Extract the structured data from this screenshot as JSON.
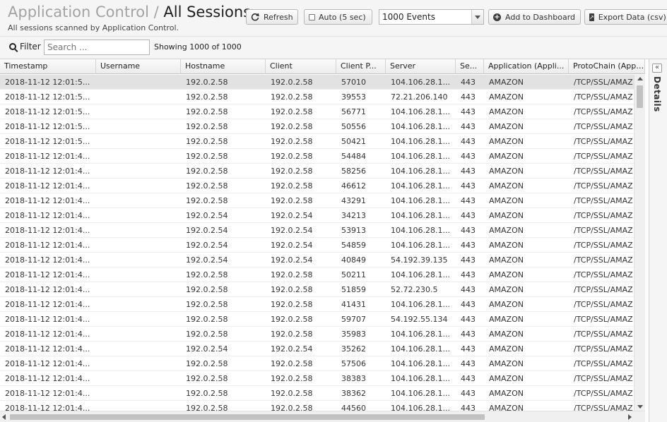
{
  "header": {
    "app_name": "Application Control",
    "separator": "/",
    "page_title": "All Sessions",
    "subtitle": "All sessions scanned by Application Control.",
    "refresh_label": "Refresh",
    "auto_label": "Auto (5 sec)",
    "events_select": "1000 Events",
    "add_dashboard_label": "Add to Dashboard",
    "export_label": "Export Data (csv)"
  },
  "filter": {
    "label": "Filter",
    "placeholder": "Search ...",
    "showing": "Showing 1000 of 1000"
  },
  "details": {
    "label": "Details",
    "collapse_icon": "«"
  },
  "grid": {
    "columns": [
      "Timestamp",
      "Username",
      "Hostname",
      "Client",
      "Client P...",
      "Server",
      "Se...",
      "Application (Appli...",
      "ProtoChain (Appl..."
    ],
    "rows": [
      [
        "2018-11-12 12:01:5...",
        "",
        "192.0.2.58",
        "192.0.2.58",
        "57010",
        "104.106.28.1...",
        "443",
        "AMAZON",
        "/TCP/SSL/AMAZ"
      ],
      [
        "2018-11-12 12:01:5...",
        "",
        "192.0.2.58",
        "192.0.2.58",
        "39553",
        "72.21.206.140",
        "443",
        "AMAZON",
        "/TCP/SSL/AMAZ"
      ],
      [
        "2018-11-12 12:01:5...",
        "",
        "192.0.2.58",
        "192.0.2.58",
        "56771",
        "104.106.28.1...",
        "443",
        "AMAZON",
        "/TCP/SSL/AMAZ"
      ],
      [
        "2018-11-12 12:01:5...",
        "",
        "192.0.2.58",
        "192.0.2.58",
        "50556",
        "104.106.28.1...",
        "443",
        "AMAZON",
        "/TCP/SSL/AMAZ"
      ],
      [
        "2018-11-12 12:01:5...",
        "",
        "192.0.2.58",
        "192.0.2.58",
        "50421",
        "104.106.28.1...",
        "443",
        "AMAZON",
        "/TCP/SSL/AMAZ"
      ],
      [
        "2018-11-12 12:01:4...",
        "",
        "192.0.2.58",
        "192.0.2.58",
        "54484",
        "104.106.28.1...",
        "443",
        "AMAZON",
        "/TCP/SSL/AMAZ"
      ],
      [
        "2018-11-12 12:01:4...",
        "",
        "192.0.2.58",
        "192.0.2.58",
        "58256",
        "104.106.28.1...",
        "443",
        "AMAZON",
        "/TCP/SSL/AMAZ"
      ],
      [
        "2018-11-12 12:01:4...",
        "",
        "192.0.2.58",
        "192.0.2.58",
        "46612",
        "104.106.28.1...",
        "443",
        "AMAZON",
        "/TCP/SSL/AMAZ"
      ],
      [
        "2018-11-12 12:01:4...",
        "",
        "192.0.2.58",
        "192.0.2.58",
        "43291",
        "104.106.28.1...",
        "443",
        "AMAZON",
        "/TCP/SSL/AMAZ"
      ],
      [
        "2018-11-12 12:01:4...",
        "",
        "192.0.2.54",
        "192.0.2.54",
        "34213",
        "104.106.28.1...",
        "443",
        "AMAZON",
        "/TCP/SSL/AMAZ"
      ],
      [
        "2018-11-12 12:01:4...",
        "",
        "192.0.2.54",
        "192.0.2.54",
        "53913",
        "104.106.28.1...",
        "443",
        "AMAZON",
        "/TCP/SSL/AMAZ"
      ],
      [
        "2018-11-12 12:01:4...",
        "",
        "192.0.2.54",
        "192.0.2.54",
        "54859",
        "104.106.28.1...",
        "443",
        "AMAZON",
        "/TCP/SSL/AMAZ"
      ],
      [
        "2018-11-12 12:01:4...",
        "",
        "192.0.2.54",
        "192.0.2.54",
        "40849",
        "54.192.39.135",
        "443",
        "AMAZON",
        "/TCP/SSL/AMAZ"
      ],
      [
        "2018-11-12 12:01:4...",
        "",
        "192.0.2.58",
        "192.0.2.58",
        "50211",
        "104.106.28.1...",
        "443",
        "AMAZON",
        "/TCP/SSL/AMAZ"
      ],
      [
        "2018-11-12 12:01:4...",
        "",
        "192.0.2.58",
        "192.0.2.58",
        "51859",
        "52.72.230.5",
        "443",
        "AMAZON",
        "/TCP/SSL/AMAZ"
      ],
      [
        "2018-11-12 12:01:4...",
        "",
        "192.0.2.58",
        "192.0.2.58",
        "41431",
        "104.106.28.1...",
        "443",
        "AMAZON",
        "/TCP/SSL/AMAZ"
      ],
      [
        "2018-11-12 12:01:4...",
        "",
        "192.0.2.58",
        "192.0.2.58",
        "59707",
        "54.192.55.134",
        "443",
        "AMAZON",
        "/TCP/SSL/AMAZ"
      ],
      [
        "2018-11-12 12:01:4...",
        "",
        "192.0.2.58",
        "192.0.2.58",
        "35983",
        "104.106.28.1...",
        "443",
        "AMAZON",
        "/TCP/SSL/AMAZ"
      ],
      [
        "2018-11-12 12:01:4...",
        "",
        "192.0.2.54",
        "192.0.2.54",
        "35262",
        "104.106.28.1...",
        "443",
        "AMAZON",
        "/TCP/SSL/AMAZ"
      ],
      [
        "2018-11-12 12:01:4...",
        "",
        "192.0.2.58",
        "192.0.2.58",
        "57506",
        "104.106.28.1...",
        "443",
        "AMAZON",
        "/TCP/SSL/AMAZ"
      ],
      [
        "2018-11-12 12:01:4...",
        "",
        "192.0.2.58",
        "192.0.2.58",
        "38383",
        "104.106.28.1...",
        "443",
        "AMAZON",
        "/TCP/SSL/AMAZ"
      ],
      [
        "2018-11-12 12:01:4...",
        "",
        "192.0.2.58",
        "192.0.2.58",
        "38362",
        "104.106.28.1...",
        "443",
        "AMAZON",
        "/TCP/SSL/AMAZ"
      ],
      [
        "2018-11-12 12:01:4...",
        "",
        "192.0.2.58",
        "192.0.2.58",
        "44560",
        "104.106.28.1...",
        "443",
        "AMAZON",
        "/TCP/SSL/AMAZ"
      ]
    ]
  }
}
